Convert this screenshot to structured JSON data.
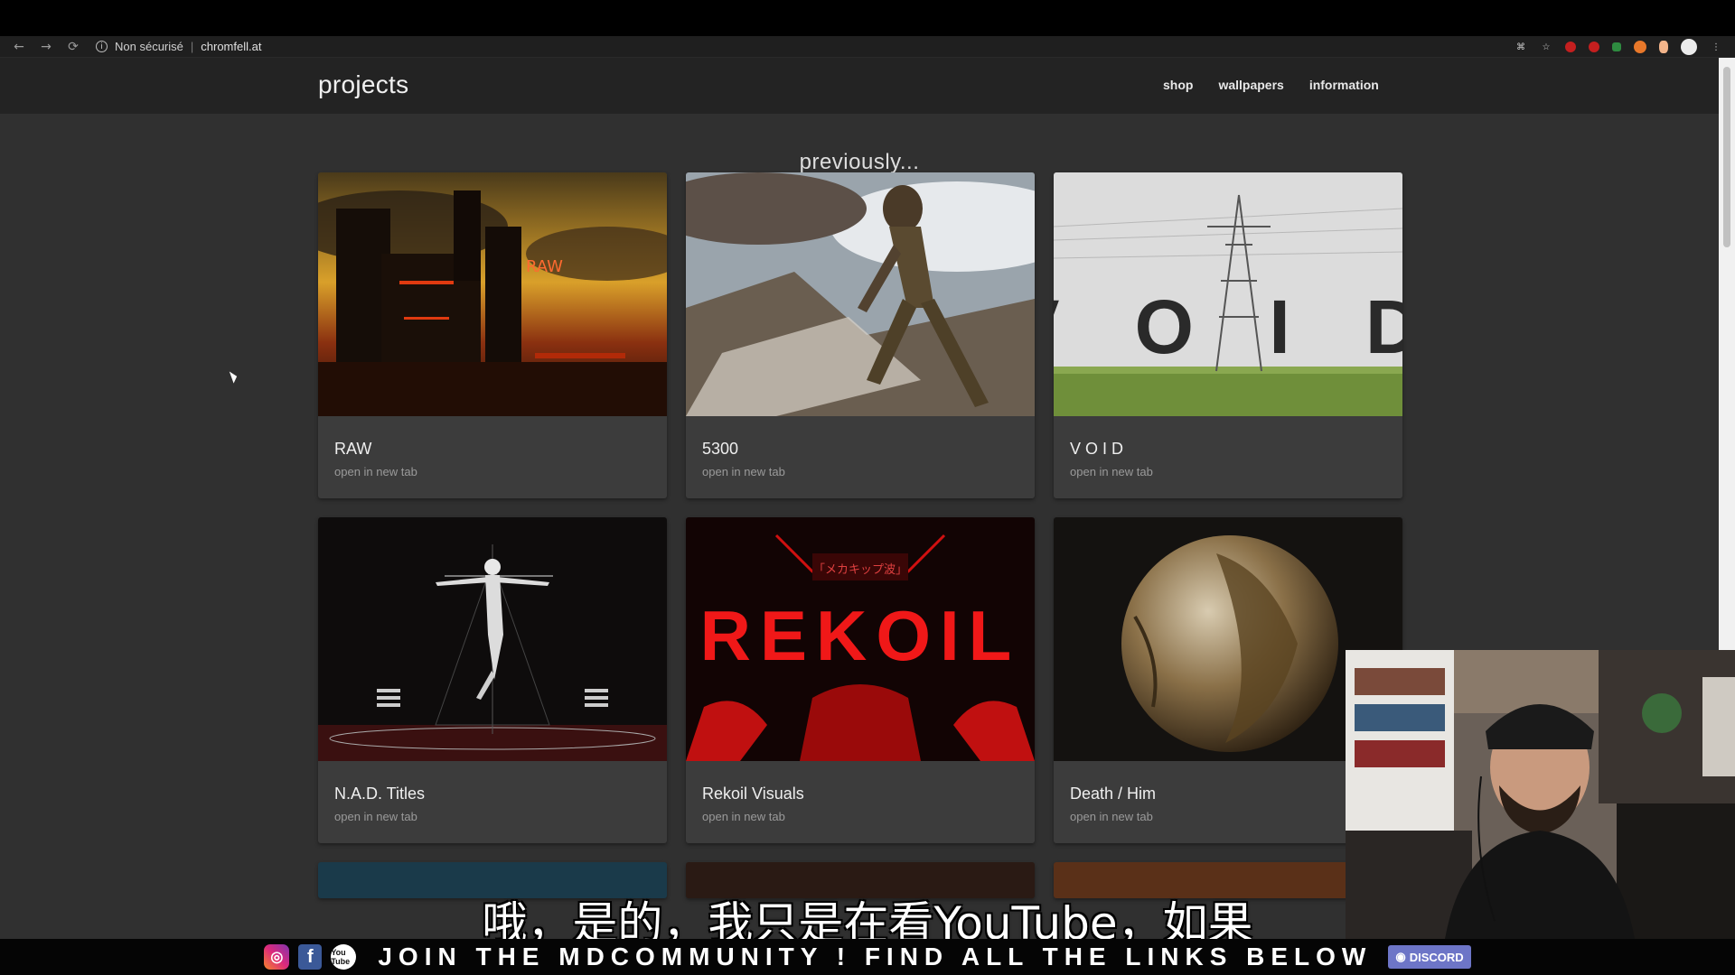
{
  "browser": {
    "back_icon": "←",
    "forward_icon": "→",
    "reload_icon": "⟳",
    "security_status": "Non sécurisé",
    "url": "chromfell.at"
  },
  "site": {
    "title": "projects",
    "nav": [
      "shop",
      "wallpapers",
      "information"
    ]
  },
  "section_title": "previously...",
  "projects": [
    {
      "title": "RAW",
      "subtitle": "open in new tab",
      "thumb_text": "RAW"
    },
    {
      "title": "5300",
      "subtitle": "open in new tab"
    },
    {
      "title": "V O I D",
      "subtitle": "open in new tab",
      "thumb_text": "V O I D"
    },
    {
      "title": "N.A.D. Titles",
      "subtitle": "open in new tab"
    },
    {
      "title": "Rekoil Visuals",
      "subtitle": "open in new tab",
      "thumb_text": "REKOIL",
      "thumb_small_text": "「メカキップ波」"
    },
    {
      "title": "Death / Him",
      "subtitle": "open in new tab"
    }
  ],
  "subtitle_caption": "哦，是的，我只是在看YouTube，如果",
  "banner": {
    "text": "JOIN THE MDCOMMUNITY ! FIND ALL THE LINKS BELOW",
    "facebook_glyph": "f",
    "youtube_glyph": "You Tube",
    "discord_label": "DISCORD"
  },
  "colors": {
    "page_bg": "#303030",
    "header_bg": "#232323",
    "card_bg": "#3c3c3c",
    "accent_red": "#c41f1f"
  }
}
